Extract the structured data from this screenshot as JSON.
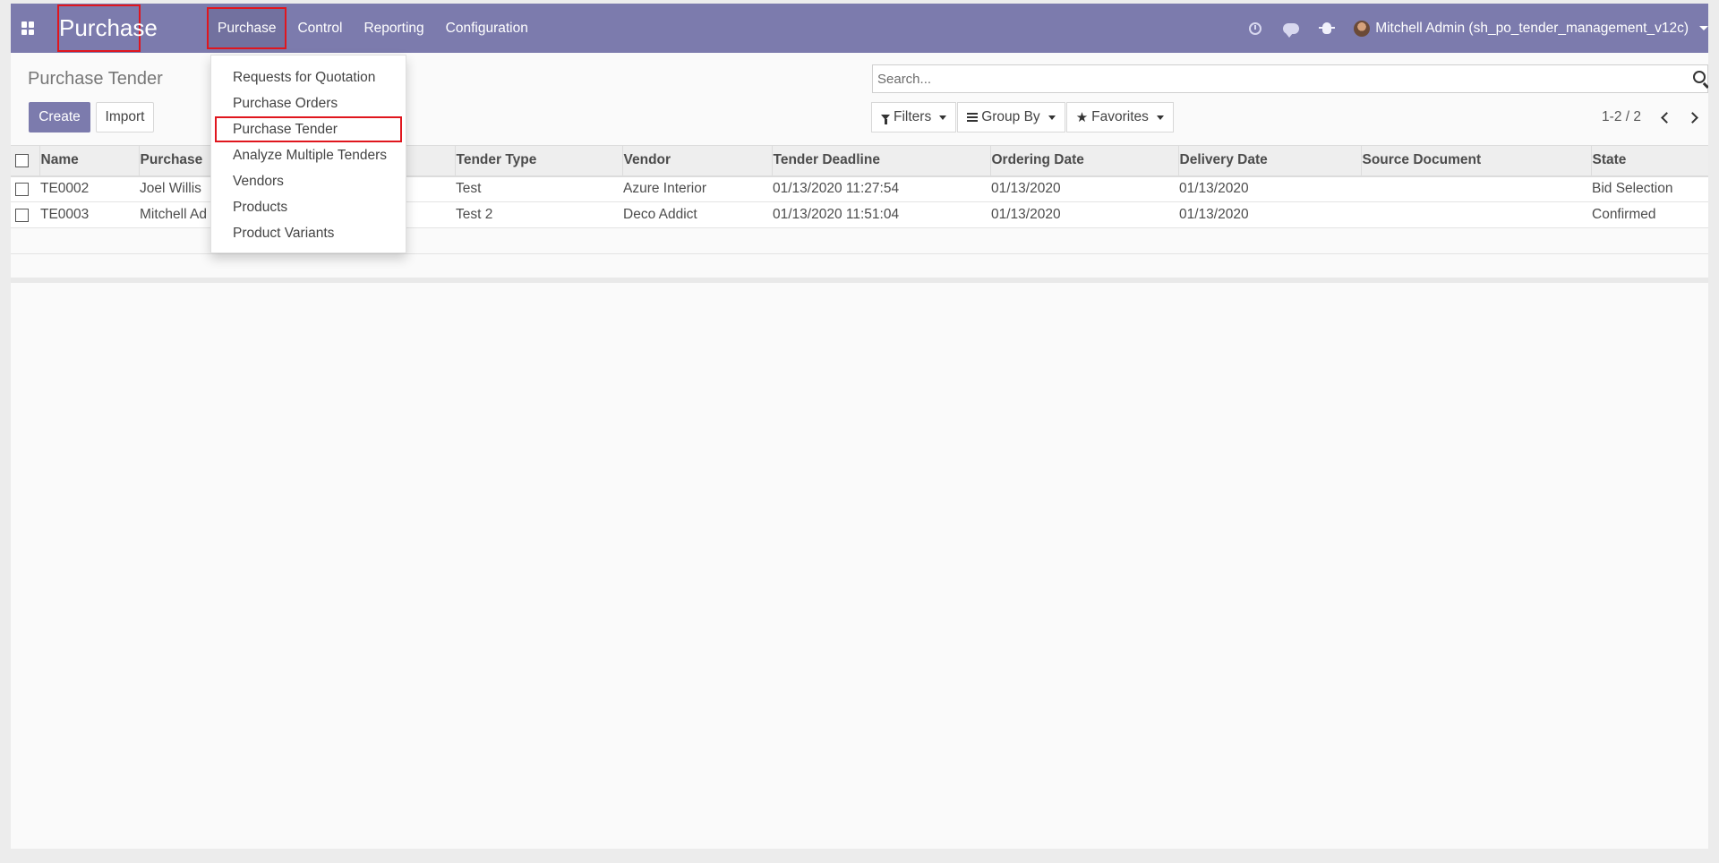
{
  "app": {
    "brand": "Purchase"
  },
  "navbar": {
    "menu": [
      {
        "label": "Purchase",
        "active": true
      },
      {
        "label": "Control"
      },
      {
        "label": "Reporting"
      },
      {
        "label": "Configuration"
      }
    ],
    "user": "Mitchell Admin (sh_po_tender_management_v12c)",
    "icons": [
      "apps-icon",
      "clock-icon",
      "chat-icon",
      "bug-icon",
      "avatar"
    ]
  },
  "dropdown": {
    "items": [
      {
        "label": "Requests for Quotation"
      },
      {
        "label": "Purchase Orders"
      },
      {
        "label": "Purchase Tender",
        "highlighted": true
      },
      {
        "label": "Analyze Multiple Tenders"
      },
      {
        "label": "Vendors"
      },
      {
        "label": "Products"
      },
      {
        "label": "Product Variants"
      }
    ]
  },
  "control_panel": {
    "title": "Purchase Tender",
    "create_label": "Create",
    "import_label": "Import",
    "search_placeholder": "Search...",
    "filters_label": "Filters",
    "groupby_label": "Group By",
    "favorites_label": "Favorites",
    "pager": "1-2 / 2"
  },
  "table": {
    "columns": [
      "Name",
      "Purchase",
      "",
      "Tender Type",
      "Vendor",
      "Tender Deadline",
      "Ordering Date",
      "Delivery Date",
      "Source Document",
      "State"
    ],
    "rows": [
      [
        "TE0002",
        "Joel Willis",
        "",
        "Test",
        "Azure Interior",
        "01/13/2020 11:27:54",
        "01/13/2020",
        "01/13/2020",
        "",
        "Bid Selection"
      ],
      [
        "TE0003",
        "Mitchell Ad",
        "",
        "Test 2",
        "Deco Addict",
        "01/13/2020 11:51:04",
        "01/13/2020",
        "01/13/2020",
        "",
        "Confirmed"
      ]
    ]
  },
  "colors": {
    "navbar": "#7c7bad",
    "highlight_border": "#e0161e"
  }
}
